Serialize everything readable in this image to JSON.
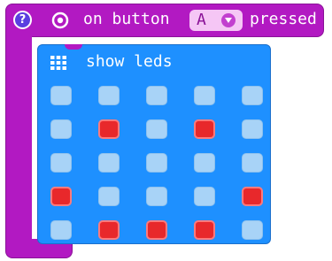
{
  "event": {
    "help_icon": "help-icon",
    "help_glyph": "?",
    "button_icon": "target-icon",
    "prefix": "on button",
    "selected_button": "A",
    "suffix": "pressed",
    "color": "#b219c2"
  },
  "show_leds": {
    "icon": "grid-icon",
    "label": "show leds",
    "color": "#1e90ff",
    "led_on_color": "#e8282b",
    "led_off_color": "#a8d3f7",
    "grid": [
      [
        0,
        0,
        0,
        0,
        0
      ],
      [
        0,
        1,
        0,
        1,
        0
      ],
      [
        0,
        0,
        0,
        0,
        0
      ],
      [
        1,
        0,
        0,
        0,
        1
      ],
      [
        0,
        1,
        1,
        1,
        0
      ]
    ]
  }
}
